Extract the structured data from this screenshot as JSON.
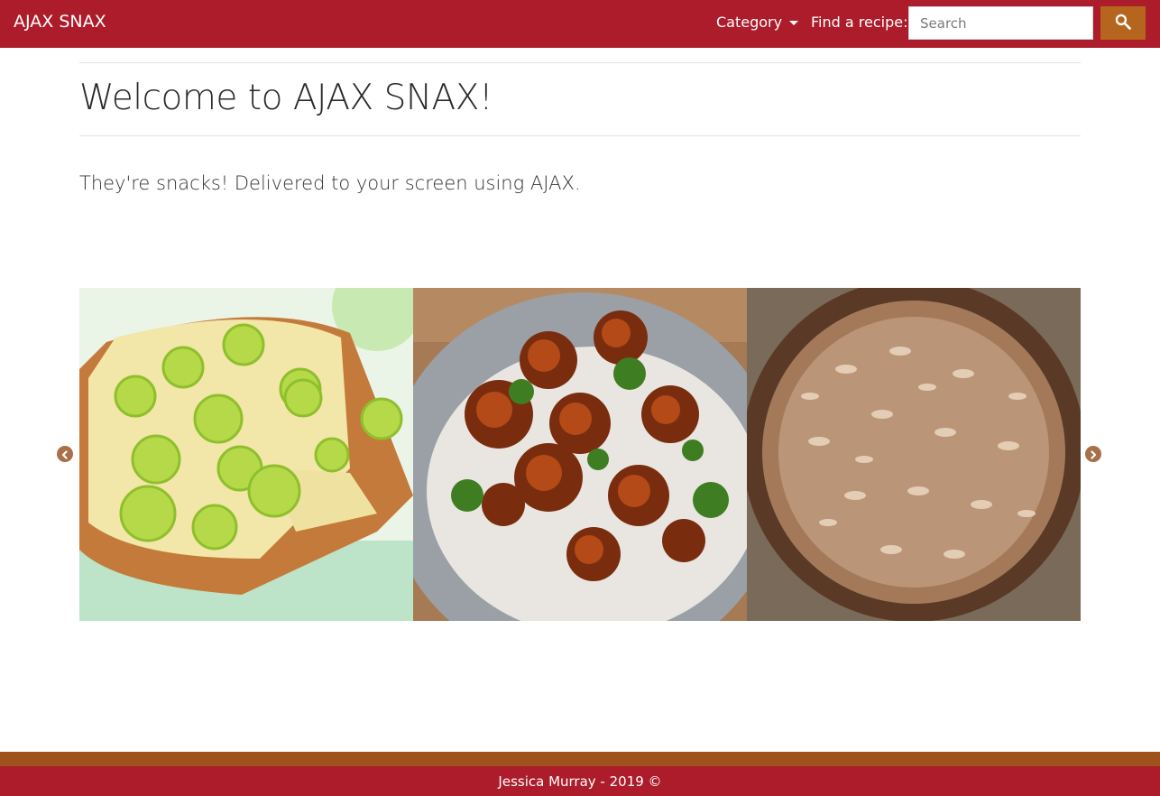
{
  "navbar": {
    "brand": "AJAX SNAX",
    "category_label": "Category",
    "find_label": "Find a recipe:",
    "search_placeholder": "Search",
    "search_icon": "search-icon"
  },
  "main": {
    "title": "Welcome to AJAX SNAX!",
    "lead": "They're snacks! Delivered to your screen using AJAX."
  },
  "carousel": {
    "slides": [
      {
        "image": "key-lime-pie"
      },
      {
        "image": "glazed-chicken-rice-bowl"
      },
      {
        "image": "almond-tart"
      }
    ],
    "prev_icon": "chevron-left-icon",
    "next_icon": "chevron-right-icon"
  },
  "footer": {
    "text": "Jessica Murray - 2019 ©"
  },
  "colors": {
    "navbar": "#ad1c2b",
    "accent": "#b5651d",
    "footer_stripe": "#a0521d"
  }
}
